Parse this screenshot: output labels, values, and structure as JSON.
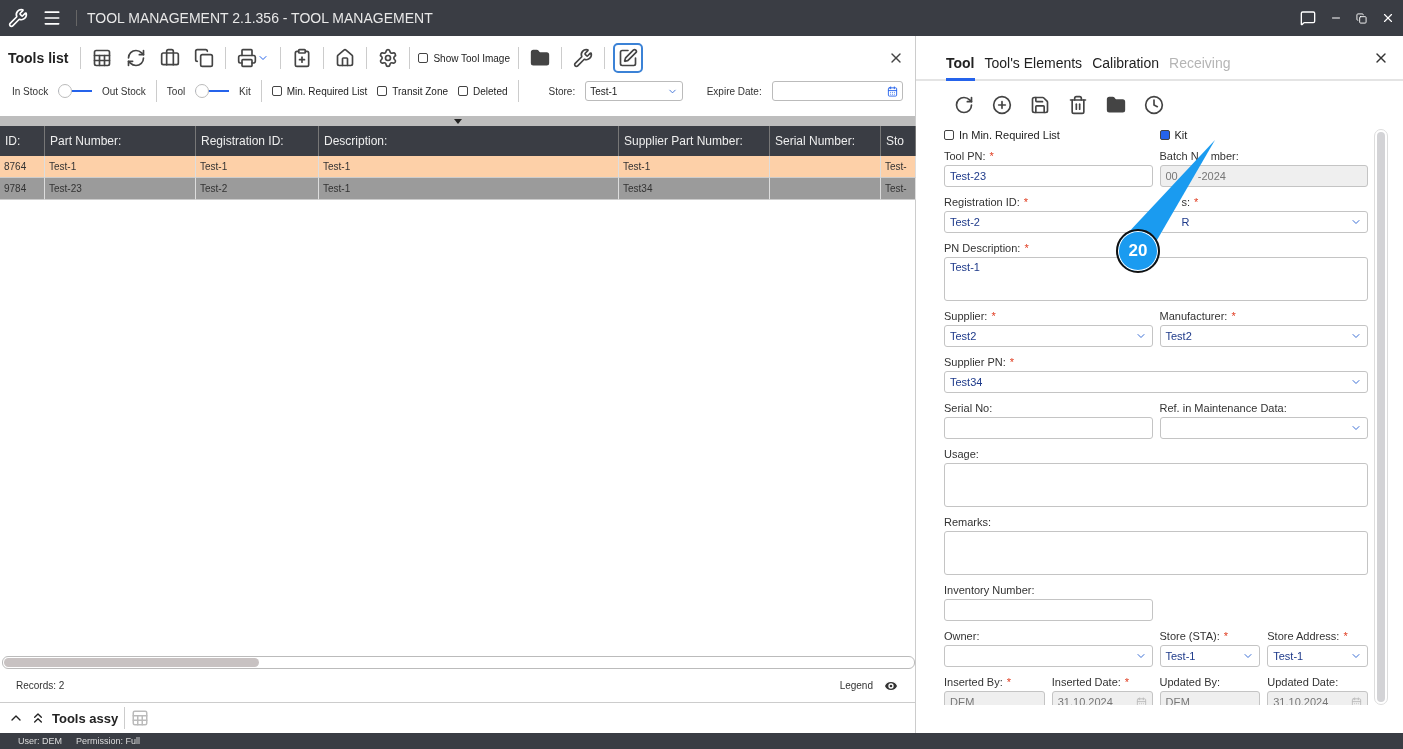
{
  "window": {
    "title": "TOOL MANAGEMENT 2.1.356 - TOOL MANAGEMENT"
  },
  "tools_list": {
    "title": "Tools list",
    "show_image": {
      "label": "Show Tool Image",
      "checked": false
    },
    "filters": [
      {
        "kind": "switch",
        "left": "In Stock",
        "right": "Out Stock",
        "on": false
      },
      {
        "kind": "switch",
        "left": "Tool",
        "right": "Kit",
        "on": false
      },
      {
        "kind": "checkbox",
        "label": "Min. Required List",
        "checked": false
      },
      {
        "kind": "checkbox",
        "label": "Transit Zone",
        "checked": false
      },
      {
        "kind": "checkbox",
        "label": "Deleted",
        "checked": false
      }
    ],
    "store": {
      "label": "Store:",
      "value": "Test-1"
    },
    "expire_date": {
      "label": "Expire Date:"
    }
  },
  "table": {
    "columns": [
      "ID:",
      "Part Number:",
      "Registration ID:",
      "Description:",
      "Supplier Part Number:",
      "Serial Number:",
      "Sto"
    ],
    "rows": [
      {
        "selected": true,
        "cells": [
          "8764",
          "Test-1",
          "Test-1",
          "Test-1",
          "Test-1",
          "",
          "Test-"
        ]
      },
      {
        "selected": false,
        "cells": [
          "9784",
          "Test-23",
          "Test-2",
          "Test-1",
          "Test34",
          "",
          "Test-"
        ]
      }
    ]
  },
  "footer": {
    "records": "Records: 2",
    "legend": "Legend"
  },
  "assy": {
    "title": "Tools assy"
  },
  "status_bar": {
    "user": "User: DEM",
    "permission": "Permission: Full"
  },
  "detail": {
    "tabs": [
      {
        "label": "Tool",
        "selected": true,
        "disabled": false
      },
      {
        "label": "Tool's Elements",
        "selected": false,
        "disabled": false
      },
      {
        "label": "Calibration",
        "selected": false,
        "disabled": false
      },
      {
        "label": "Receiving",
        "selected": false,
        "disabled": true
      }
    ],
    "checks": [
      {
        "label": "In Min. Required List",
        "checked": false
      },
      {
        "label": "Kit",
        "checked": true
      }
    ],
    "rows": [
      [
        {
          "label": "Tool PN:",
          "required_mark": "*",
          "kind": "text",
          "value": "Test-23",
          "disabled": false
        },
        null,
        {
          "label": "Batch N",
          "label_tail": "mber:",
          "kind": "text",
          "value": "00",
          "value_tail": "-2024",
          "disabled": true
        },
        null
      ],
      [
        {
          "label": "Registration ID:",
          "required_mark": "*",
          "kind": "text",
          "value": "Test-2",
          "disabled": false
        },
        null,
        {
          "label_tail": "s:",
          "required_mark": "*",
          "kind": "select",
          "value_tail": "R",
          "disabled": false
        },
        null
      ],
      [
        {
          "label": "PN Description:",
          "required_mark": "*",
          "kind": "textarea",
          "value": "Test-1",
          "disabled": false
        },
        null,
        null,
        null
      ],
      [
        {
          "label": "Supplier:",
          "required_mark": "*",
          "kind": "select",
          "value": "Test2",
          "disabled": false
        },
        null,
        {
          "label": "Manufacturer:",
          "required_mark": "*",
          "kind": "select",
          "value": "Test2",
          "disabled": false
        },
        null
      ],
      [
        {
          "label": "Supplier PN:",
          "required_mark": "*",
          "kind": "select",
          "value": "Test34",
          "disabled": false
        },
        null,
        null,
        null
      ],
      [
        {
          "label": "Serial No:",
          "kind": "text",
          "disabled": false
        },
        null,
        {
          "label": "Ref. in Maintenance Data:",
          "kind": "select",
          "disabled": false
        },
        null
      ],
      [
        {
          "label": "Usage:",
          "kind": "textarea",
          "disabled": false
        },
        null,
        null,
        null
      ],
      [
        {
          "label": "Remarks:",
          "kind": "textarea",
          "disabled": false
        },
        null,
        null,
        null
      ],
      [
        {
          "label": "Inventory Number:",
          "kind": "text",
          "disabled": false
        },
        null
      ],
      [
        {
          "label": "Owner:",
          "kind": "select",
          "disabled": false
        },
        null,
        {
          "label": "Store (STA):",
          "required_mark": "*",
          "kind": "select",
          "value": "Test-1",
          "disabled": false
        },
        {
          "label": "Store Address:",
          "required_mark": "*",
          "kind": "select",
          "value": "Test-1",
          "disabled": false
        }
      ],
      [
        {
          "label": "Inserted By:",
          "required_mark": "*",
          "kind": "text",
          "value": "DEM",
          "disabled": true
        },
        {
          "label": "Inserted Date:",
          "required_mark": "*",
          "kind": "date",
          "value": "31.10.2024",
          "disabled": true
        },
        {
          "label": "Updated By:",
          "kind": "text",
          "value": "DEM",
          "disabled": true
        },
        {
          "label": "Updated Date:",
          "kind": "date",
          "value": "31.10.2024",
          "disabled": true
        }
      ]
    ]
  },
  "callout": {
    "number": "20"
  }
}
